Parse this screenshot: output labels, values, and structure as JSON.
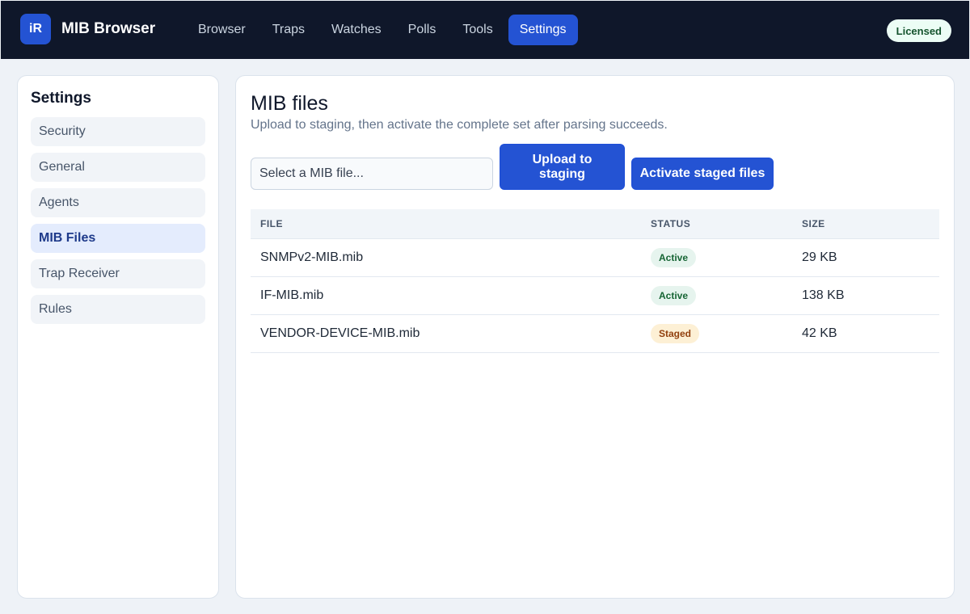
{
  "app": {
    "logo_text": "iR",
    "name": "MIB Browser",
    "license": "Licensed"
  },
  "nav": {
    "items": [
      {
        "label": "Browser"
      },
      {
        "label": "Traps"
      },
      {
        "label": "Watches"
      },
      {
        "label": "Polls"
      },
      {
        "label": "Tools"
      },
      {
        "label": "Settings",
        "active": true
      }
    ]
  },
  "sidebar": {
    "title": "Settings",
    "items": [
      {
        "label": "Security"
      },
      {
        "label": "General"
      },
      {
        "label": "Agents"
      },
      {
        "label": "MIB Files",
        "active": true
      },
      {
        "label": "Trap Receiver"
      },
      {
        "label": "Rules"
      }
    ]
  },
  "main": {
    "title": "MIB files",
    "subtitle": "Upload to staging, then activate the complete set after parsing succeeds.",
    "file_select_placeholder": "Select a MIB file...",
    "upload_label": "Upload to staging",
    "activate_label": "Activate staged files",
    "table": {
      "columns": [
        "FILE",
        "STATUS",
        "SIZE"
      ],
      "rows": [
        {
          "file": "SNMPv2-MIB.mib",
          "status": "Active",
          "size": "29 KB"
        },
        {
          "file": "IF-MIB.mib",
          "status": "Active",
          "size": "138 KB"
        },
        {
          "file": "VENDOR-DEVICE-MIB.mib",
          "status": "Staged",
          "size": "42 KB"
        }
      ]
    }
  },
  "colors": {
    "accent": "#2453d3",
    "topbar": "#0f172a",
    "active_badge": "#166534",
    "staged_badge": "#92400e"
  }
}
